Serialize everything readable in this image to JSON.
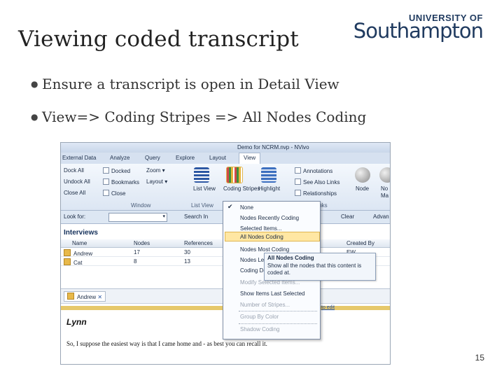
{
  "slide": {
    "title": "Viewing coded transcript",
    "bullets": [
      "Ensure a transcript is open in Detail View",
      "View=> Coding Stripes => All Nodes Coding"
    ],
    "page_number": "15"
  },
  "logo": {
    "top": "UNIVERSITY OF",
    "main": "Southampton"
  },
  "app": {
    "window_title": "Demo for NCRM.nvp - NVivo",
    "tabs": [
      "External Data",
      "Analyze",
      "Query",
      "Explore",
      "Layout",
      "View"
    ],
    "ribbon": {
      "window_group": {
        "label": "Window",
        "items": [
          "Dock All",
          "Undock All",
          "Close All",
          "Docked",
          "Bookmarks",
          "Close",
          "Zoom",
          "Layout"
        ]
      },
      "list_view": {
        "label": "List View",
        "button": "List View"
      },
      "coding_stripes": "Coding Stripes",
      "highlight": "Highlight",
      "links_group": {
        "label": "Links",
        "items": [
          "Annotations",
          "See Also Links",
          "Relationships"
        ]
      },
      "node": "Node",
      "more": [
        "No",
        "Ma"
      ]
    },
    "look_for": {
      "label": "Look for:",
      "search_in": "Search In",
      "clear": "Clear",
      "advanced": "Advan"
    },
    "list": {
      "title": "Interviews",
      "columns": [
        "Name",
        "Nodes",
        "References",
        "Created By"
      ],
      "rows": [
        {
          "name": "Andrew",
          "nodes": "17",
          "references": "30",
          "created_by": "EW"
        },
        {
          "name": "Cat",
          "nodes": "8",
          "references": "13",
          "created_by": "EW"
        }
      ]
    },
    "detail": {
      "tab": "Andrew",
      "click_to_edit": "to edit",
      "speaker": "Lynn",
      "text": "So, I suppose the easiest way is that I came home and - as best you can recall it."
    },
    "menu": {
      "items": [
        {
          "label": "None",
          "checked": true,
          "disabled": false
        },
        {
          "label": "Nodes Recently Coding",
          "disabled": false
        },
        {
          "label": "Selected Items...",
          "disabled": false
        },
        {
          "label": "All Nodes Coding",
          "disabled": false,
          "highlighted": true
        },
        {
          "label": "Nodes Most Coding",
          "disabled": false
        },
        {
          "label": "Nodes Le",
          "disabled": false
        },
        {
          "label": "Coding De",
          "disabled": false
        },
        {
          "label": "Modify Selected Items...",
          "disabled": true
        },
        {
          "label": "Show Items Last Selected",
          "disabled": false
        },
        {
          "label": "Number of Stripes...",
          "disabled": true
        },
        {
          "label": "Group By Color",
          "disabled": true
        },
        {
          "label": "Shadow Coding",
          "disabled": true
        }
      ],
      "tooltip_title": "All Nodes Coding",
      "tooltip_text": "Show all the nodes that this content is coded at."
    }
  }
}
